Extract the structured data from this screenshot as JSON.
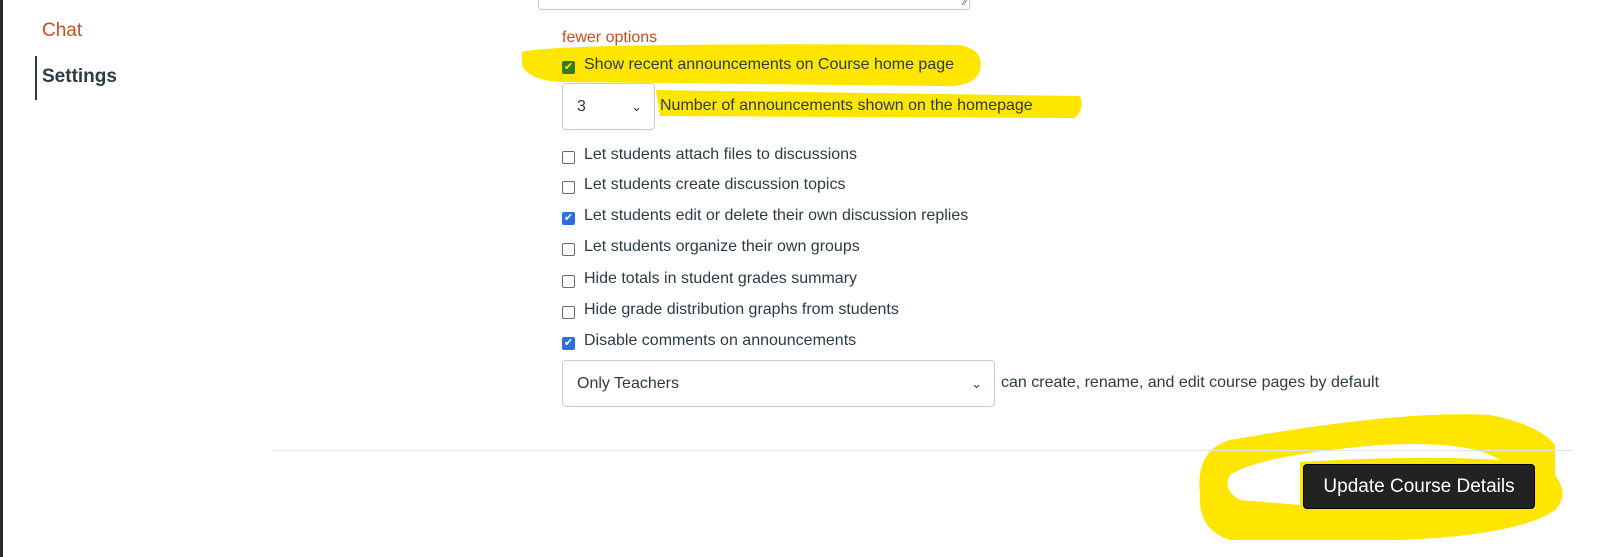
{
  "sidebar": {
    "items": [
      {
        "label": "Chat",
        "active": false
      },
      {
        "label": "Settings",
        "active": true
      }
    ]
  },
  "options": {
    "toggle_link": "fewer options",
    "show_announcements": {
      "label": "Show recent announcements on Course home page",
      "checked": true
    },
    "announcement_count": {
      "value": "3",
      "label": "Number of announcements shown on the homepage"
    },
    "checkboxes": [
      {
        "label": "Let students attach files to discussions",
        "checked": false
      },
      {
        "label": "Let students create discussion topics",
        "checked": false
      },
      {
        "label": "Let students edit or delete their own discussion replies",
        "checked": true
      },
      {
        "label": "Let students organize their own groups",
        "checked": false
      },
      {
        "label": "Hide totals in student grades summary",
        "checked": false
      },
      {
        "label": "Hide grade distribution graphs from students",
        "checked": false
      },
      {
        "label": "Disable comments on announcements",
        "checked": true
      }
    ],
    "pages_permission": {
      "value": "Only Teachers",
      "label": "can create, rename, and edit course pages by default"
    }
  },
  "actions": {
    "update_label": "Update Course Details"
  },
  "colors": {
    "accent": "#c9501c",
    "highlight": "#ffe600",
    "checkbox": "#2d6fe0",
    "button": "#222222"
  }
}
